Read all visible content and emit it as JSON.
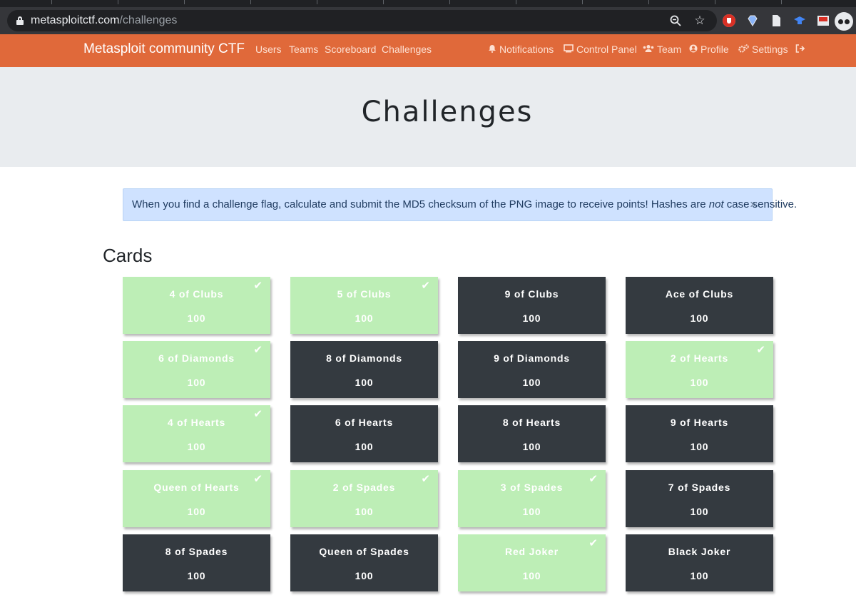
{
  "browser": {
    "url_host": "metasploitctf.com",
    "url_path": "/challenges"
  },
  "navbar": {
    "brand": "Metasploit community CTF",
    "left_links": [
      "Users",
      "Teams",
      "Scoreboard",
      "Challenges"
    ],
    "right_links": [
      {
        "label": "Notifications",
        "icon": "bell-icon"
      },
      {
        "label": "Control Panel",
        "icon": "monitor-icon"
      },
      {
        "label": "Team",
        "icon": "users-icon"
      },
      {
        "label": "Profile",
        "icon": "user-circle-icon"
      },
      {
        "label": "Settings",
        "icon": "cogs-icon"
      },
      {
        "label": "",
        "icon": "logout-icon"
      }
    ]
  },
  "page": {
    "title": "Challenges",
    "alert_before": "When you find a challenge flag, calculate and submit the MD5 checksum of the PNG image to receive points! Hashes are ",
    "alert_emphasis": "not",
    "alert_after": " case sensitive.",
    "alert_close": "×"
  },
  "category": {
    "name": "Cards",
    "challenges": [
      {
        "name": "4 of Clubs",
        "value": "100",
        "solved": true
      },
      {
        "name": "5 of Clubs",
        "value": "100",
        "solved": true
      },
      {
        "name": "9 of Clubs",
        "value": "100",
        "solved": false
      },
      {
        "name": "Ace of Clubs",
        "value": "100",
        "solved": false
      },
      {
        "name": "6 of Diamonds",
        "value": "100",
        "solved": true
      },
      {
        "name": "8 of Diamonds",
        "value": "100",
        "solved": false
      },
      {
        "name": "9 of Diamonds",
        "value": "100",
        "solved": false
      },
      {
        "name": "2 of Hearts",
        "value": "100",
        "solved": true
      },
      {
        "name": "4 of Hearts",
        "value": "100",
        "solved": true
      },
      {
        "name": "6 of Hearts",
        "value": "100",
        "solved": false
      },
      {
        "name": "8 of Hearts",
        "value": "100",
        "solved": false
      },
      {
        "name": "9 of Hearts",
        "value": "100",
        "solved": false
      },
      {
        "name": "Queen of Hearts",
        "value": "100",
        "solved": true
      },
      {
        "name": "2 of Spades",
        "value": "100",
        "solved": true
      },
      {
        "name": "3 of Spades",
        "value": "100",
        "solved": true
      },
      {
        "name": "7 of Spades",
        "value": "100",
        "solved": false
      },
      {
        "name": "8 of Spades",
        "value": "100",
        "solved": false
      },
      {
        "name": "Queen of Spades",
        "value": "100",
        "solved": false
      },
      {
        "name": "Red Joker",
        "value": "100",
        "solved": true
      },
      {
        "name": "Black Joker",
        "value": "100",
        "solved": false
      }
    ]
  },
  "colors": {
    "navbar": "#e0693a",
    "solved": "#bdeeb6",
    "unsolved": "#343a40",
    "alert": "#cfe2ff"
  }
}
